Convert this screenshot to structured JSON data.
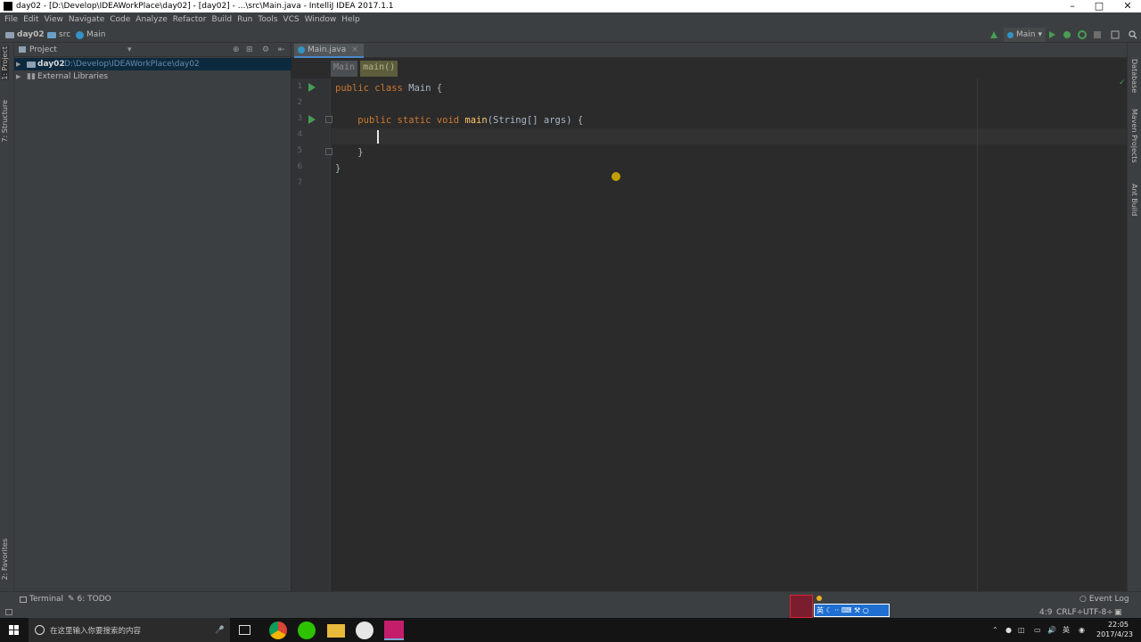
{
  "window": {
    "title": "day02 - [D:\\Develop\\IDEAWorkPlace\\day02] - [day02] - ...\\src\\Main.java - IntelliJ IDEA 2017.1.1"
  },
  "menu": [
    "File",
    "Edit",
    "View",
    "Navigate",
    "Code",
    "Analyze",
    "Refactor",
    "Build",
    "Run",
    "Tools",
    "VCS",
    "Window",
    "Help"
  ],
  "nav": {
    "project": "day02",
    "folder": "src",
    "file": "Main",
    "run_config": "Main"
  },
  "left_stripe": {
    "project_tab": "1: Project",
    "structure_tab": "7: Structure",
    "favorites_tab": "2: Favorites"
  },
  "project_panel": {
    "header": "Project",
    "tree": [
      {
        "name": "day02",
        "path": "D:\\Develop\\IDEAWorkPlace\\day02"
      },
      {
        "name": "External Libraries",
        "path": ""
      }
    ]
  },
  "editor": {
    "tab": "Main.java",
    "breadcrumbs": [
      "Main",
      "main()"
    ],
    "line_numbers": [
      "1",
      "2",
      "3",
      "4",
      "5",
      "6",
      "7"
    ]
  },
  "right_stripe": {
    "database": "Database",
    "maven": "Maven Projects",
    "ant": "Ant Build"
  },
  "bottom": {
    "terminal": "Terminal",
    "todo": "6: TODO",
    "event_log": "Event Log",
    "position": "4:9",
    "line_sep": "CRLF÷",
    "encoding": "UTF-8÷"
  },
  "ime": {
    "label": "英"
  },
  "taskbar": {
    "search_placeholder": "在这里输入你要搜索的内容",
    "time": "22:05",
    "date": "2017/4/23",
    "lang": "英"
  },
  "colors": {
    "accent": "#4a88c7",
    "run_green": "#499c54",
    "keyword": "#cc7832",
    "method": "#ffc66d"
  }
}
